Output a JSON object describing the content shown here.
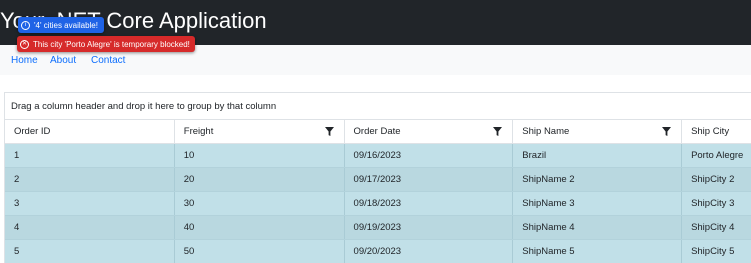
{
  "app": {
    "title": "Your .NET Core Application"
  },
  "nav": {
    "home": "Home",
    "about": "About",
    "contact": "Contact"
  },
  "toasts": {
    "info": {
      "icon": "info-icon",
      "text": "'4' cities available!",
      "color": "#1f63e6"
    },
    "error": {
      "icon": "error-icon",
      "text": "This city 'Porto Alegre' is temporary blocked!",
      "color": "#d62a2a"
    }
  },
  "grid": {
    "group_panel_text": "Drag a column header and drop it here to group by that column",
    "columns": [
      {
        "label": "Order ID",
        "filter_icon": false
      },
      {
        "label": "Freight",
        "filter_icon": true
      },
      {
        "label": "Order Date",
        "filter_icon": true
      },
      {
        "label": "Ship Name",
        "filter_icon": true
      },
      {
        "label": "Ship City",
        "filter_icon": false
      }
    ],
    "rows": [
      [
        "1",
        "10",
        "09/16/2023",
        "Brazil",
        "Porto Alegre"
      ],
      [
        "2",
        "20",
        "09/17/2023",
        "ShipName 2",
        "ShipCity 2"
      ],
      [
        "3",
        "30",
        "09/18/2023",
        "ShipName 3",
        "ShipCity 3"
      ],
      [
        "4",
        "40",
        "09/19/2023",
        "ShipName 4",
        "ShipCity 4"
      ],
      [
        "5",
        "50",
        "09/20/2023",
        "ShipName 5",
        "ShipCity 5"
      ]
    ],
    "row_color": "#c1e0e8"
  }
}
